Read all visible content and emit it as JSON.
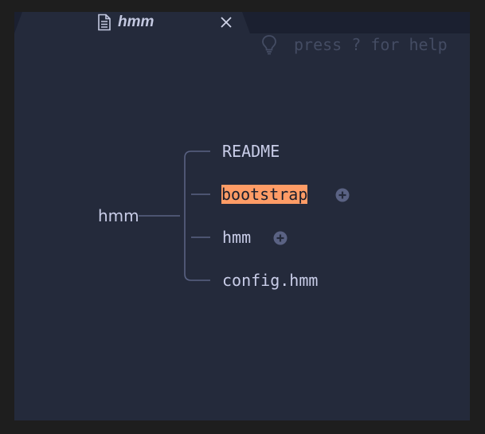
{
  "tab": {
    "title": "hmm",
    "doc_icon": "document-icon",
    "close_icon": "close-icon"
  },
  "help": {
    "icon": "lightbulb-icon",
    "text": "press ? for help"
  },
  "mindmap": {
    "root": "hmm",
    "children": [
      {
        "label": "README",
        "collapsed": false,
        "selected": false
      },
      {
        "label": "bootstrap",
        "collapsed": true,
        "selected": true
      },
      {
        "label": "hmm",
        "collapsed": true,
        "selected": false
      },
      {
        "label": "config.hmm",
        "collapsed": false,
        "selected": false
      }
    ]
  },
  "colors": {
    "background": "#242a3b",
    "tabbar": "#1b2030",
    "text": "#c9cde8",
    "dim_text": "#444c63",
    "line": "#5a6283",
    "selection": "#ff9c66"
  }
}
